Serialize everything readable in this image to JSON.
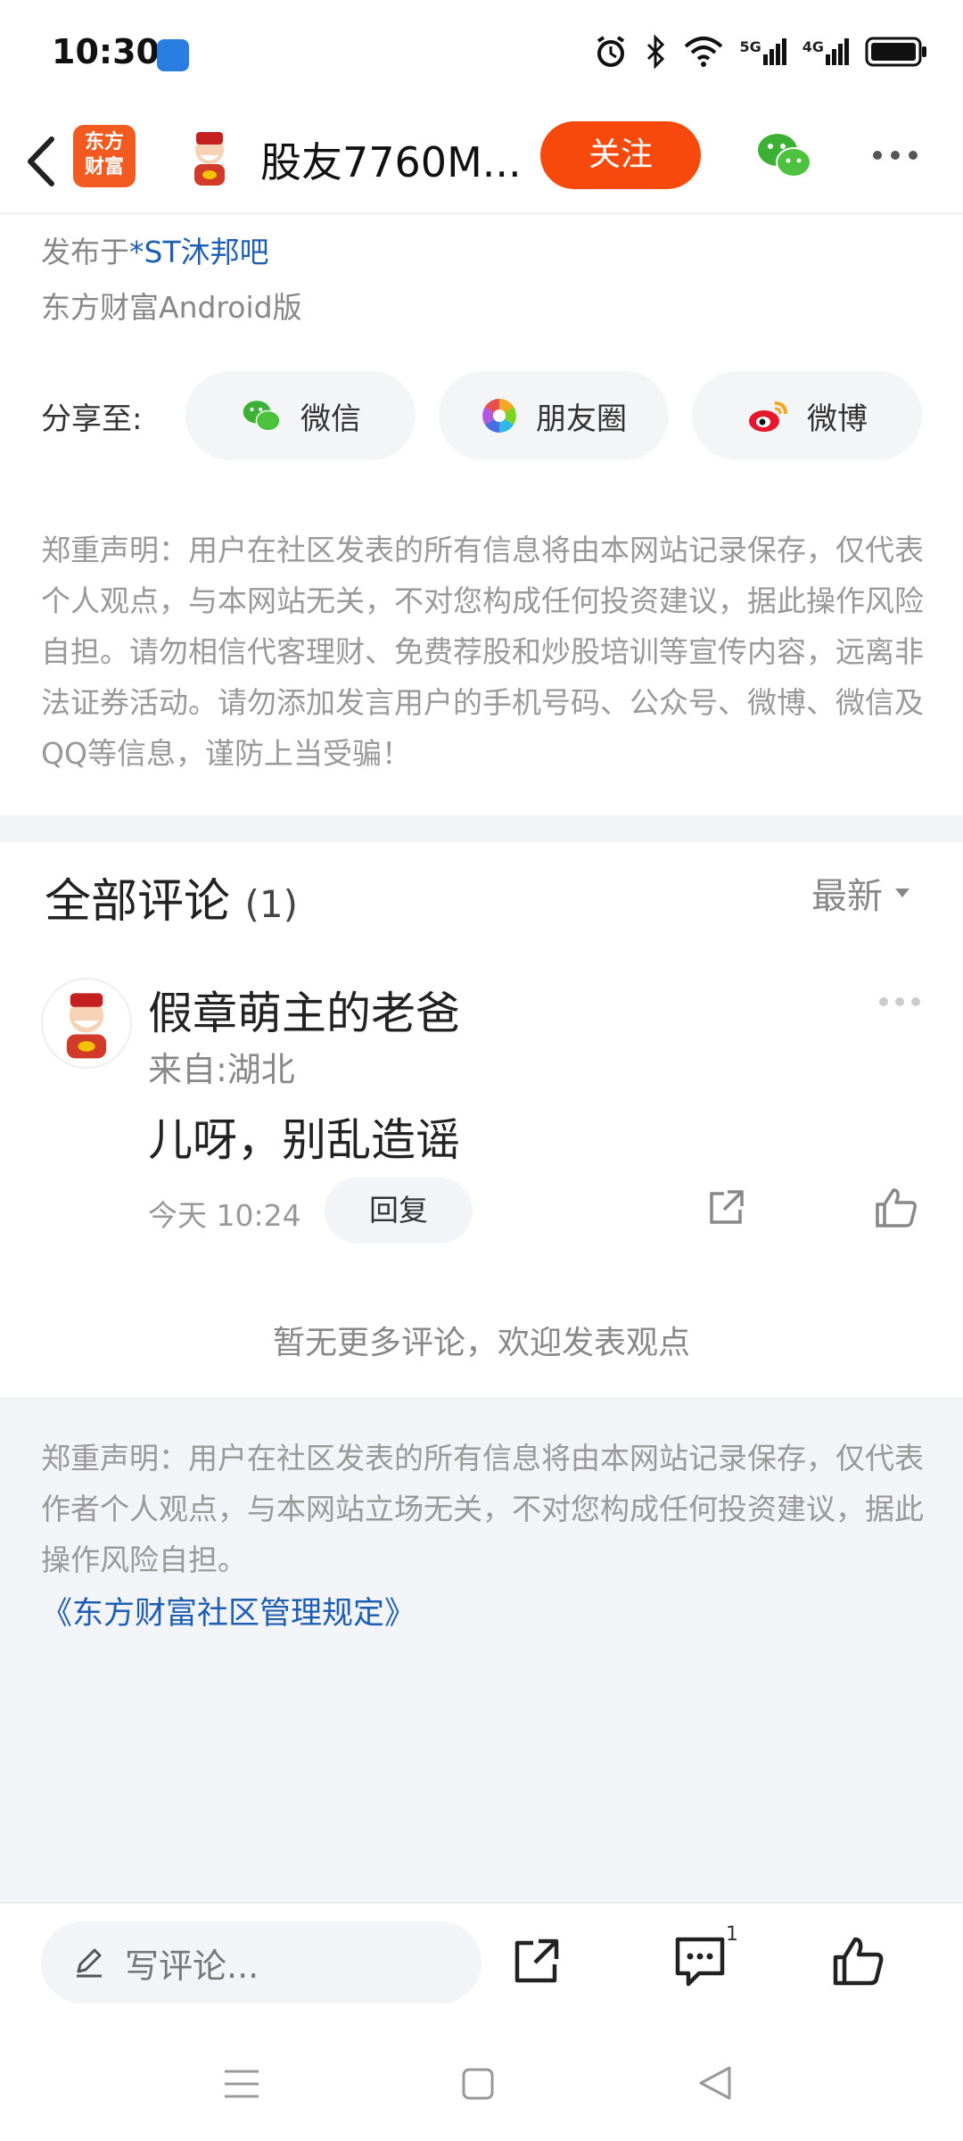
{
  "status_bar": {
    "time": "10:30",
    "network_5g": "5G",
    "network_4g": "4G"
  },
  "header": {
    "logo_text_line1": "东方",
    "logo_text_line2": "财富",
    "author_name": "股友7760M...",
    "follow_label": "关注"
  },
  "post": {
    "published_in_prefix": "发布于",
    "published_in_link": "*ST沐邦吧",
    "platform": "东方财富Android版"
  },
  "share": {
    "label": "分享至:",
    "wechat": "微信",
    "moments": "朋友圈",
    "weibo": "微博"
  },
  "disclaimer_top": "郑重声明：用户在社区发表的所有信息将由本网站记录保存，仅代表个人观点，与本网站无关，不对您构成任何投资建议，据此操作风险自担。请勿相信代客理财、免费荐股和炒股培训等宣传内容，远离非法证券活动。请勿添加发言用户的手机号码、公众号、微博、微信及QQ等信息，谨防上当受骗！",
  "comments": {
    "title": "全部评论",
    "count": "(1)",
    "sort_label": "最新",
    "items": [
      {
        "user": "假章萌主的老爸",
        "location": "来自:湖北",
        "text": "儿呀，别乱造谣",
        "time": "今天 10:24",
        "reply_label": "回复"
      }
    ],
    "no_more": "暂无更多评论，欢迎发表观点"
  },
  "disclaimer_bottom": "郑重声明：用户在社区发表的所有信息将由本网站记录保存，仅代表作者个人观点，与本网站立场无关，不对您构成任何投资建议，据此操作风险自担。",
  "rules_link": "《东方财富社区管理规定》",
  "bottom_bar": {
    "comment_placeholder": "写评论...",
    "comment_count": "1"
  },
  "colors": {
    "accent": "#f6490b",
    "link": "#1e5fb3",
    "wechat_green": "#3cb034",
    "weibo_red": "#e6162d"
  }
}
